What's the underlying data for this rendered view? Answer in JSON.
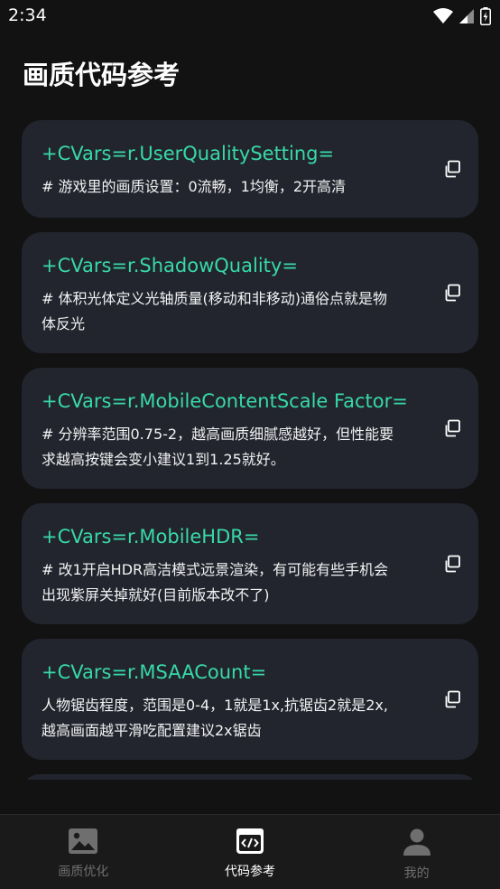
{
  "status_bar": {
    "time": "2:34"
  },
  "page": {
    "title": "画质代码参考"
  },
  "cards": [
    {
      "code": "+CVars=r.UserQualitySetting=",
      "description": "# 游戏里的画质设置：0流畅，1均衡，2开高清"
    },
    {
      "code": "+CVars=r.ShadowQuality=",
      "description": "# 体积光体定义光轴质量(移动和非移动)通俗点就是物体反光"
    },
    {
      "code": "+CVars=r.MobileContentScale Factor=",
      "description": "# 分辨率范围0.75-2，越高画质细腻感越好，但性能要求越高按键会变小建议1到1.25就好。"
    },
    {
      "code": "+CVars=r.MobileHDR=",
      "description": "# 改1开启HDR高洁模式远景渲染，有可能有些手机会出现紫屏关掉就好(目前版本改不了)"
    },
    {
      "code": "+CVars=r.MSAACount=",
      "description": "人物锯齿程度，范围是0-4，1就是1x,抗锯齿2就是2x,越高画面越平滑吃配置建议2x锯齿"
    }
  ],
  "bottom_nav": {
    "items": [
      {
        "label": "画质优化",
        "icon": "image-icon",
        "active": false
      },
      {
        "label": "代码参考",
        "icon": "code-icon",
        "active": true
      },
      {
        "label": "我的",
        "icon": "person-icon",
        "active": false
      }
    ]
  },
  "colors": {
    "background": "#121212",
    "card": "#22252e",
    "accent": "#38d9a9",
    "nav_inactive": "#6f6f6f"
  }
}
